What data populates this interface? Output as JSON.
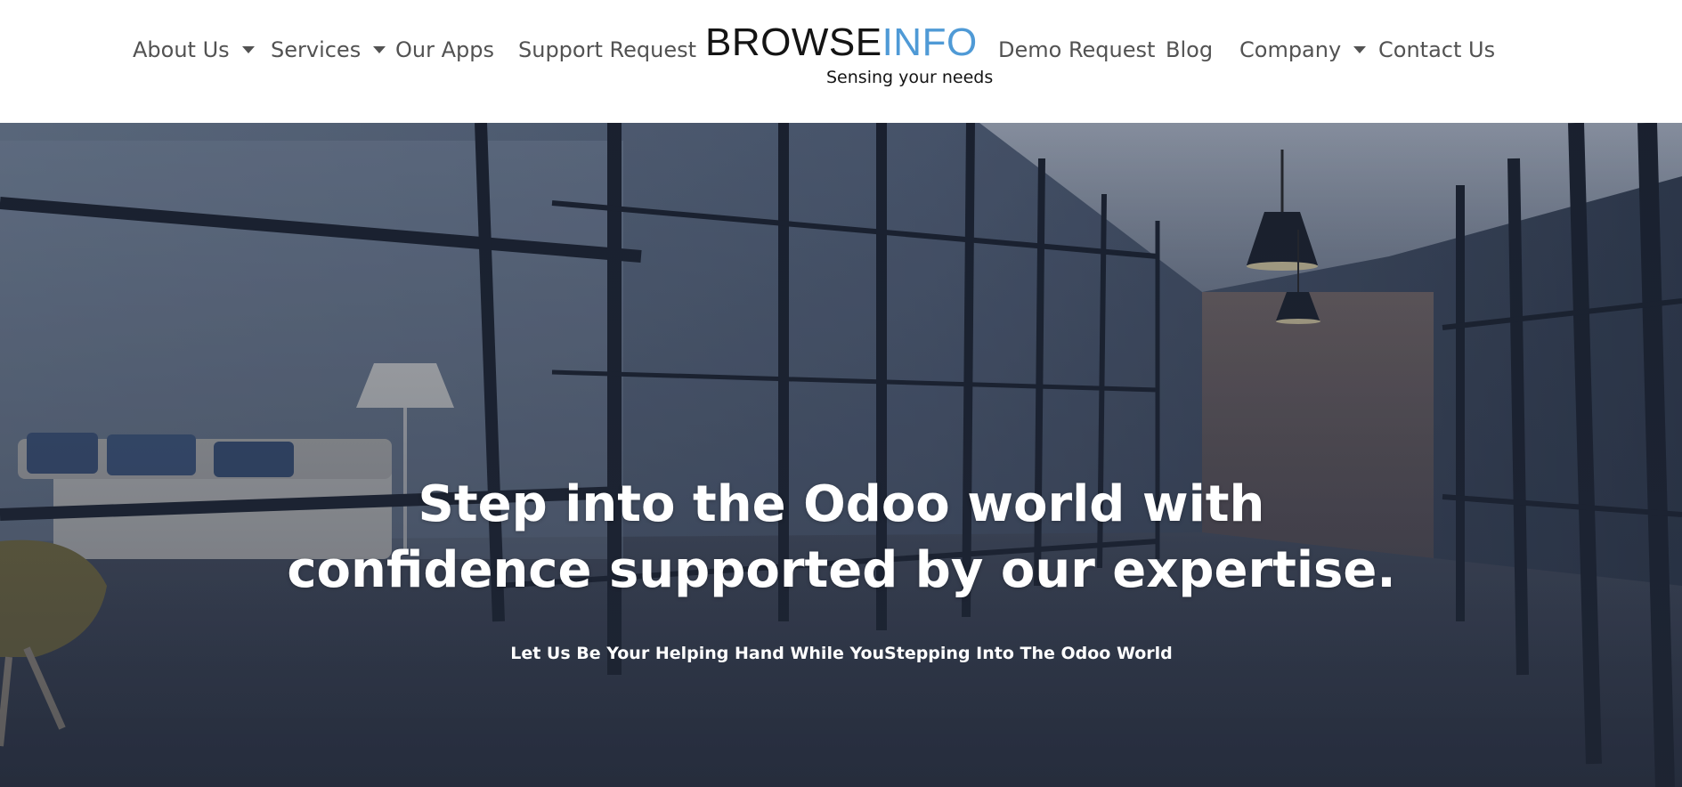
{
  "nav": {
    "about_us": "About Us",
    "services": "Services",
    "our_apps": "Our Apps",
    "support_request": "Support Request",
    "demo_request": "Demo Request",
    "blog": "Blog",
    "company": "Company",
    "contact_us": "Contact Us"
  },
  "logo": {
    "word_dark": "BROWSE",
    "word_blue": "INFO",
    "tagline": "Sensing your needs"
  },
  "hero": {
    "title_line1": "Step into the Odoo world with",
    "title_line2": "confidence supported by our expertise.",
    "subtitle": "Let Us Be Your Helping Hand While YouStepping Into The Odoo World"
  },
  "colors": {
    "nav_text": "#525252",
    "logo_blue": "#4f9ad6",
    "logo_dark": "#141414",
    "hero_overlay": "#2f3a4d"
  },
  "icons": {
    "dropdown": "chevron-down-icon"
  }
}
